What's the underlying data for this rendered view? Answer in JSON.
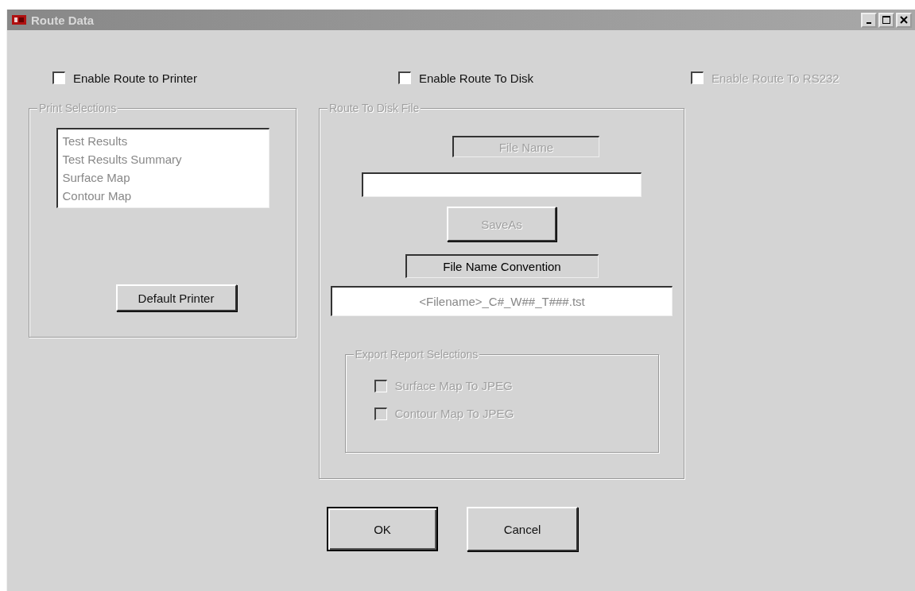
{
  "window": {
    "title": "Route Data"
  },
  "route_options": [
    {
      "label": "Enable Route to Printer",
      "checked": false,
      "disabled": false
    },
    {
      "label": "Enable Route To Disk",
      "checked": false,
      "disabled": false
    },
    {
      "label": "Enable Route To RS232",
      "checked": false,
      "disabled": true
    }
  ],
  "print_selections": {
    "title": "Print Selections",
    "disabled": true,
    "items": [
      "Test Results",
      "Test Results Summary",
      "Surface Map",
      "Contour Map"
    ],
    "button": "Default Printer"
  },
  "route_to_disk": {
    "title": "Route To Disk File",
    "disabled": true,
    "file_name_label": "File Name",
    "save_as_button": {
      "label": "SaveAs",
      "disabled": true
    },
    "convention_label": "File Name Convention",
    "convention_value": "<Filename>_C#_W##_T###.tst",
    "export": {
      "title": "Export Report Selections",
      "options": [
        {
          "label": "Surface Map To JPEG",
          "checked": false,
          "disabled": true
        },
        {
          "label": "Contour Map To JPEG",
          "checked": false,
          "disabled": true
        }
      ]
    }
  },
  "buttons": [
    {
      "label": "OK",
      "default": true
    },
    {
      "label": "Cancel",
      "default": false
    }
  ]
}
